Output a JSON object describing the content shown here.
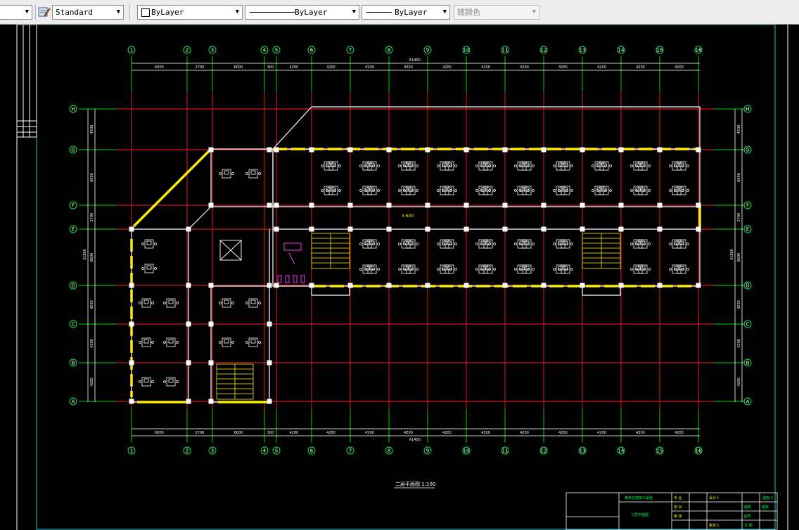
{
  "toolbar": {
    "textstyle_value": "Standard",
    "layer_value": "ByLayer",
    "linetype_value": "ByLayer",
    "lineweight_value": "ByLayer",
    "plotstyle_value": "随颜色"
  },
  "drawing": {
    "grid_cols_top": [
      "1",
      "2",
      "3",
      "4",
      "5",
      "6",
      "7",
      "8",
      "9",
      "10",
      "11",
      "12",
      "13",
      "14",
      "15",
      "16"
    ],
    "grid_cols_bottom": [
      "1",
      "2",
      "3",
      "4",
      "5",
      "6",
      "7",
      "8",
      "9",
      "10",
      "11",
      "12",
      "13",
      "14",
      "15",
      "16"
    ],
    "grid_rows": [
      "H",
      "G",
      "F",
      "E",
      "D",
      "C",
      "B",
      "A"
    ],
    "top_overall_dim": "61450",
    "bottom_overall_dim": "61450",
    "top_dims": [
      "6000",
      "2700",
      "6000",
      "300",
      "4200",
      "4200",
      "4200",
      "4200",
      "4200",
      "4200",
      "4200",
      "4200",
      "4200",
      "4200",
      "4200"
    ],
    "bottom_dims": [
      "6000",
      "2700",
      "6000",
      "300",
      "4200",
      "4200",
      "4200",
      "4200",
      "4200",
      "4200",
      "4200",
      "4200",
      "4200",
      "4200",
      "4200"
    ],
    "left_dims": [
      "4500",
      "6000",
      "2700",
      "8600",
      "4200",
      "4200",
      "4200"
    ],
    "left_overall_dim": "31800",
    "right_dims": [
      "4500",
      "6000",
      "2700",
      "8600",
      "4200",
      "4200",
      "4200"
    ],
    "right_overall_dim": "31800",
    "level_mark": "3.600",
    "sheet_title": "二层平面图  1:100"
  },
  "title_block": {
    "project": "某商住楼施工图纸",
    "drawing_name": "二层平面图",
    "sheet_no": "建施-3",
    "row_labels": [
      "专 业",
      "校 对",
      "审 核",
      "设计人",
      "审定人"
    ],
    "values": [
      "建筑",
      "建筑",
      "图号",
      "日 期"
    ]
  }
}
